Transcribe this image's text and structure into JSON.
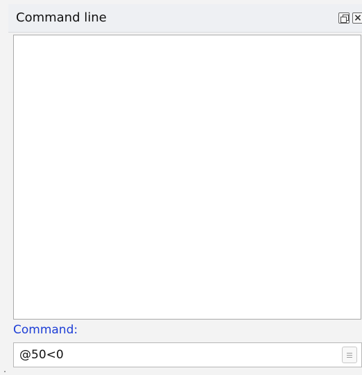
{
  "panel": {
    "title": "Command line",
    "float_icon": "float-window-icon",
    "close_icon": "close-icon"
  },
  "output": {
    "text": ""
  },
  "command": {
    "label": "Command:",
    "value": "@50<0",
    "history_icon": "history-list-icon"
  },
  "colors": {
    "label_blue": "#1c3dd6",
    "titlebar_bg": "#eef0f3",
    "panel_bg": "#f3f3f3"
  }
}
